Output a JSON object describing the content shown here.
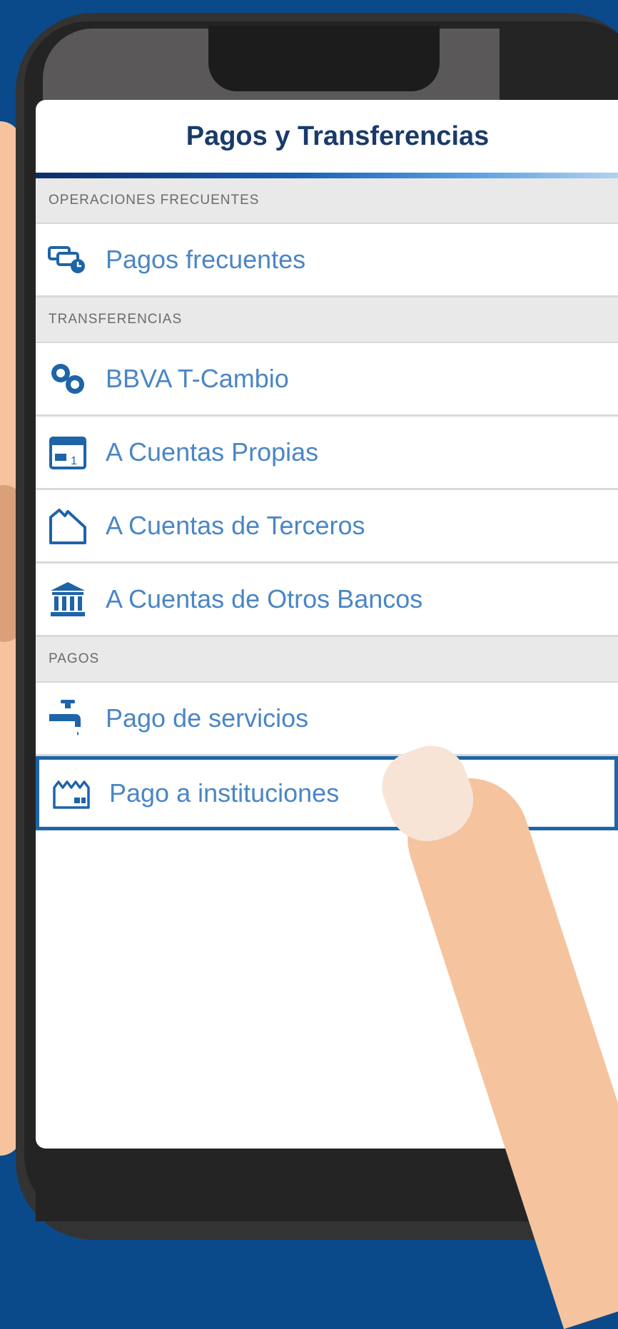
{
  "header": {
    "title": "Pagos y Transferencias"
  },
  "sections": [
    {
      "title": "OPERACIONES FRECUENTES",
      "items": [
        {
          "label": "Pagos frecuentes",
          "icon": "cards-clock-icon"
        }
      ]
    },
    {
      "title": "TRANSFERENCIAS",
      "items": [
        {
          "label": "BBVA T-Cambio",
          "icon": "currency-exchange-icon"
        },
        {
          "label": "A Cuentas Propias",
          "icon": "calendar-account-icon"
        },
        {
          "label": "A Cuentas de Terceros",
          "icon": "house-icon"
        },
        {
          "label": "A Cuentas de Otros Bancos",
          "icon": "bank-icon"
        }
      ]
    },
    {
      "title": "PAGOS",
      "items": [
        {
          "label": "Pago de servicios",
          "icon": "faucet-icon"
        },
        {
          "label": "Pago a instituciones",
          "icon": "factory-icon",
          "selected": true
        }
      ]
    }
  ],
  "colors": {
    "title": "#1b3a6b",
    "item_text": "#4a86c5",
    "selected_border": "#1e64a8",
    "background": "#0b4a8a"
  }
}
